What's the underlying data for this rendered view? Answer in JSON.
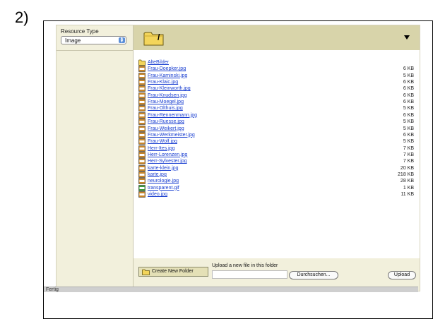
{
  "step_label": "2)",
  "sidebar": {
    "resource_type_label": "Resource Type",
    "resource_type_value": "Image"
  },
  "topbar": {
    "current_path": "/",
    "folder_icon": "folder-icon",
    "dropdown_icon": "triangle-down-icon"
  },
  "files": [
    {
      "name": "AlteBilder",
      "size": "",
      "type": "folder"
    },
    {
      "name": "Frau-Doepker.jpg",
      "size": "6 KB",
      "type": "jpg"
    },
    {
      "name": "Frau-Kaminski.jpg",
      "size": "5 KB",
      "type": "jpg"
    },
    {
      "name": "Frau-Klaic.jpg",
      "size": "6 KB",
      "type": "jpg"
    },
    {
      "name": "Frau-Kleinworth.jpg",
      "size": "6 KB",
      "type": "jpg"
    },
    {
      "name": "Frau-Knudsen.jpg",
      "size": "6 KB",
      "type": "jpg"
    },
    {
      "name": "Frau-Moegel.jpg",
      "size": "6 KB",
      "type": "jpg"
    },
    {
      "name": "Frau-Olthuis.jpg",
      "size": "5 KB",
      "type": "jpg"
    },
    {
      "name": "Frau-Rennenmann.jpg",
      "size": "6 KB",
      "type": "jpg"
    },
    {
      "name": "Frau-Ruesse.jpg",
      "size": "5 KB",
      "type": "jpg"
    },
    {
      "name": "Frau-Weikert.jpg",
      "size": "5 KB",
      "type": "jpg"
    },
    {
      "name": "Frau-Werkmeister.jpg",
      "size": "6 KB",
      "type": "jpg"
    },
    {
      "name": "Frau-Wolf.jpg",
      "size": "5 KB",
      "type": "jpg"
    },
    {
      "name": "Herr-Ites.jpg",
      "size": "7 KB",
      "type": "jpg"
    },
    {
      "name": "Herr-Lorenzen.jpg",
      "size": "7 KB",
      "type": "jpg"
    },
    {
      "name": "Herr-Sylvester.jpg",
      "size": "7 KB",
      "type": "jpg"
    },
    {
      "name": "karte-klein.jpg",
      "size": "20 KB",
      "type": "jpg"
    },
    {
      "name": "karte.jpg",
      "size": "218 KB",
      "type": "jpg"
    },
    {
      "name": "neurologie.jpg",
      "size": "28 KB",
      "type": "jpg"
    },
    {
      "name": "transparent.gif",
      "size": "1 KB",
      "type": "gif"
    },
    {
      "name": "video.jpg",
      "size": "11 KB",
      "type": "jpg"
    }
  ],
  "bottombar": {
    "create_folder_label": "Create New Folder",
    "upload_label": "Upload a new file in this folder",
    "browse_label": "Durchsuchen...",
    "upload_button_label": "Upload"
  },
  "statusbar": {
    "text": "Fertig"
  },
  "colors": {
    "folder": "#f3d55b",
    "jpg_icon": "#c8862a",
    "gif_icon": "#3d9a3d",
    "link": "#1a3fd1"
  }
}
